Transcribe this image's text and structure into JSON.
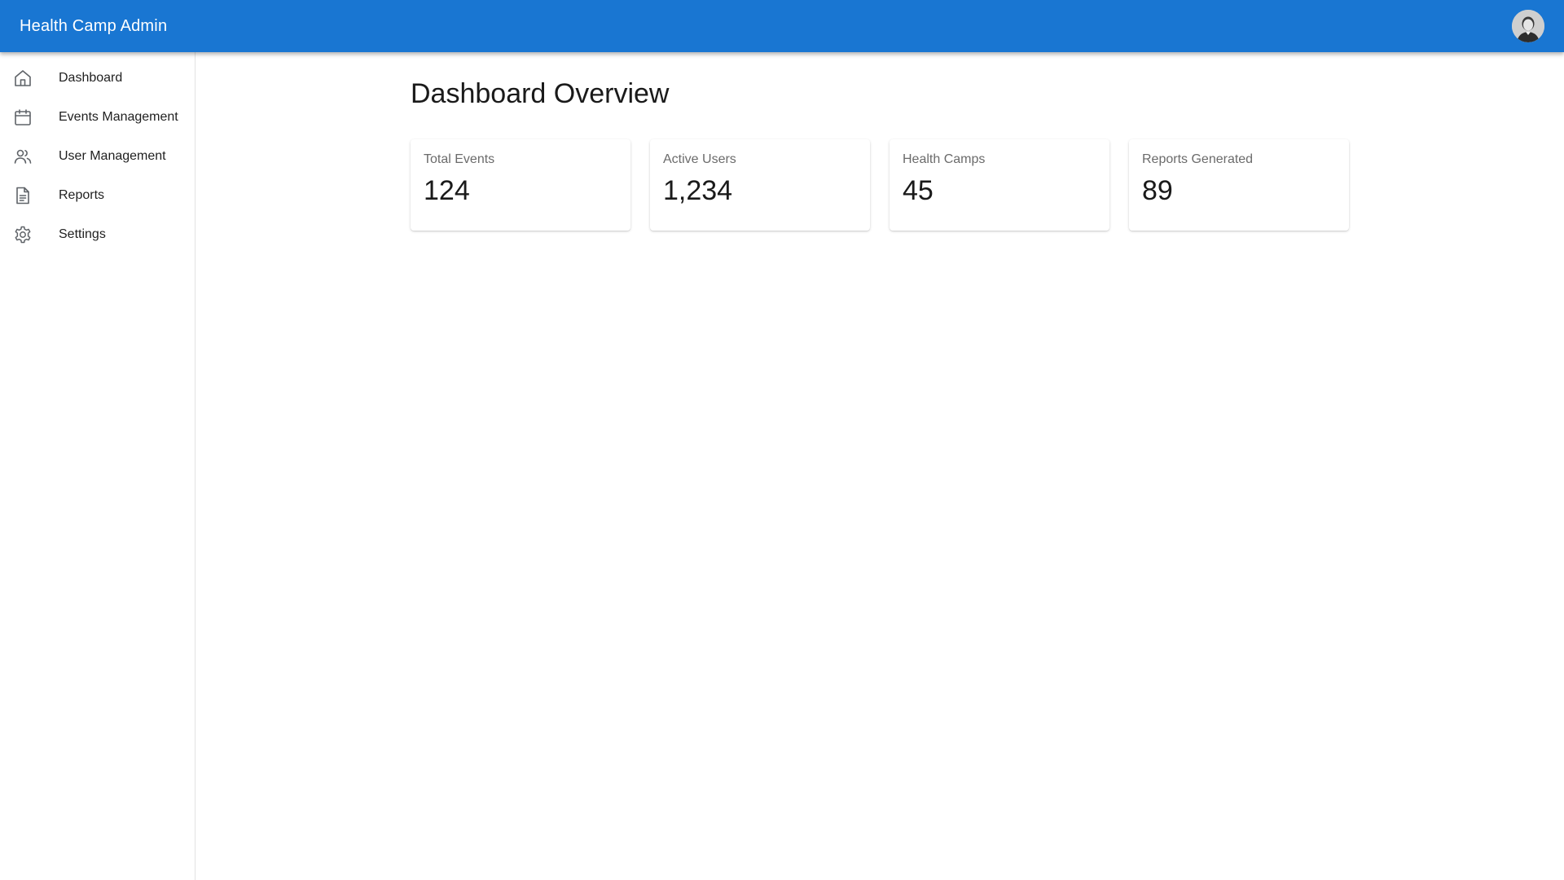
{
  "header": {
    "title": "Health Camp Admin",
    "avatar_icon": "user-avatar",
    "accent_color": "#1976d2"
  },
  "sidebar": {
    "items": [
      {
        "label": "Dashboard",
        "icon": "home-icon"
      },
      {
        "label": "Events Management",
        "icon": "calendar-icon"
      },
      {
        "label": "User Management",
        "icon": "users-icon"
      },
      {
        "label": "Reports",
        "icon": "document-icon"
      },
      {
        "label": "Settings",
        "icon": "gear-icon"
      }
    ]
  },
  "main": {
    "title": "Dashboard Overview",
    "stats": [
      {
        "label": "Total Events",
        "value": "124"
      },
      {
        "label": "Active Users",
        "value": "1,234"
      },
      {
        "label": "Health Camps",
        "value": "45"
      },
      {
        "label": "Reports Generated",
        "value": "89"
      }
    ]
  }
}
